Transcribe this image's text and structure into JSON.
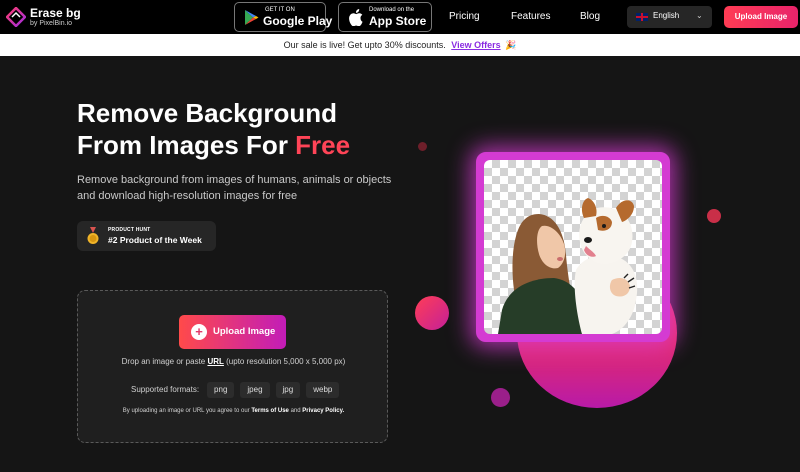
{
  "nav": {
    "logo_title": "Erase bg",
    "logo_sub": "by PixelBin.io",
    "google_play": {
      "small": "GET IT ON",
      "big": "Google Play"
    },
    "app_store": {
      "small": "Download on the",
      "big": "App Store"
    },
    "links": [
      "Pricing",
      "Features",
      "Blog"
    ],
    "language": "English",
    "upload_button": "Upload Image"
  },
  "banner": {
    "text": "Our sale is live! Get upto 30% discounts.",
    "link": "View Offers",
    "emoji": "🎉"
  },
  "hero": {
    "title_line1": "Remove Background",
    "title_line2_prefix": "From Images For ",
    "title_highlight": "Free",
    "description": "Remove background from images of humans, animals or objects and download high-resolution images for free",
    "badge": {
      "small": "PRODUCT HUNT",
      "big": "#2 Product of the Week"
    }
  },
  "upload": {
    "button_label": "Upload Image",
    "drop_prefix": "Drop an image or paste ",
    "drop_url": "URL",
    "drop_suffix": " (upto resolution 5,000 x 5,000 px)",
    "formats_label": "Supported formats:",
    "formats": [
      "png",
      "jpeg",
      "jpg",
      "webp"
    ],
    "terms_prefix": "By uploading an image or URL you agree to our ",
    "terms_link": "Terms of Use",
    "terms_and": " and ",
    "privacy_link": "Privacy Policy."
  },
  "colors": {
    "accent": "#ff4457",
    "gradient_start": "#ff4a4a",
    "gradient_end": "#c21cb8",
    "link": "#8a2be2"
  }
}
